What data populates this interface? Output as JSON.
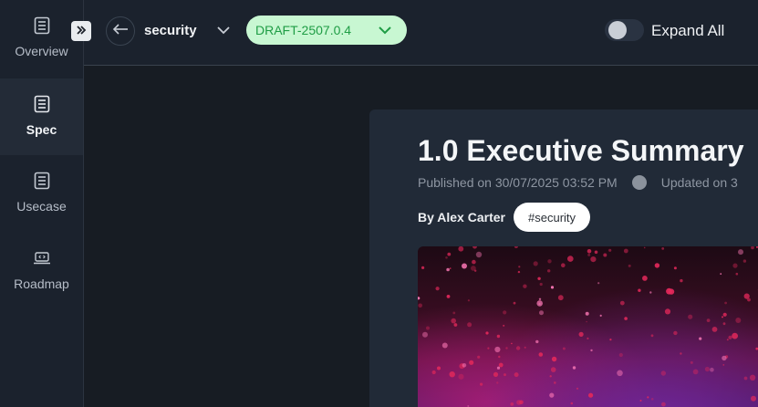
{
  "sidebar": {
    "items": [
      {
        "label": "Overview",
        "icon": "document-list-icon"
      },
      {
        "label": "Spec",
        "icon": "document-list-icon",
        "active": true
      },
      {
        "label": "Usecase",
        "icon": "document-list-icon"
      },
      {
        "label": "Roadmap",
        "icon": "laptop-code-icon"
      }
    ],
    "collapse_icon": "double-chevron-right-icon"
  },
  "header": {
    "back_icon": "arrow-left-icon",
    "project_name": "security",
    "version": "DRAFT-2507.0.4",
    "expand_all_label": "Expand All",
    "expand_all_on": false
  },
  "document": {
    "title": "1.0 Executive Summary",
    "published": "Published on 30/07/2025 03:52 PM",
    "updated": "Updated on 3",
    "author": "By Alex Carter",
    "tag": "#security"
  },
  "colors": {
    "version_pill_bg": "#c8f7d2",
    "version_text": "#1f9d45",
    "background": "#171c23"
  }
}
